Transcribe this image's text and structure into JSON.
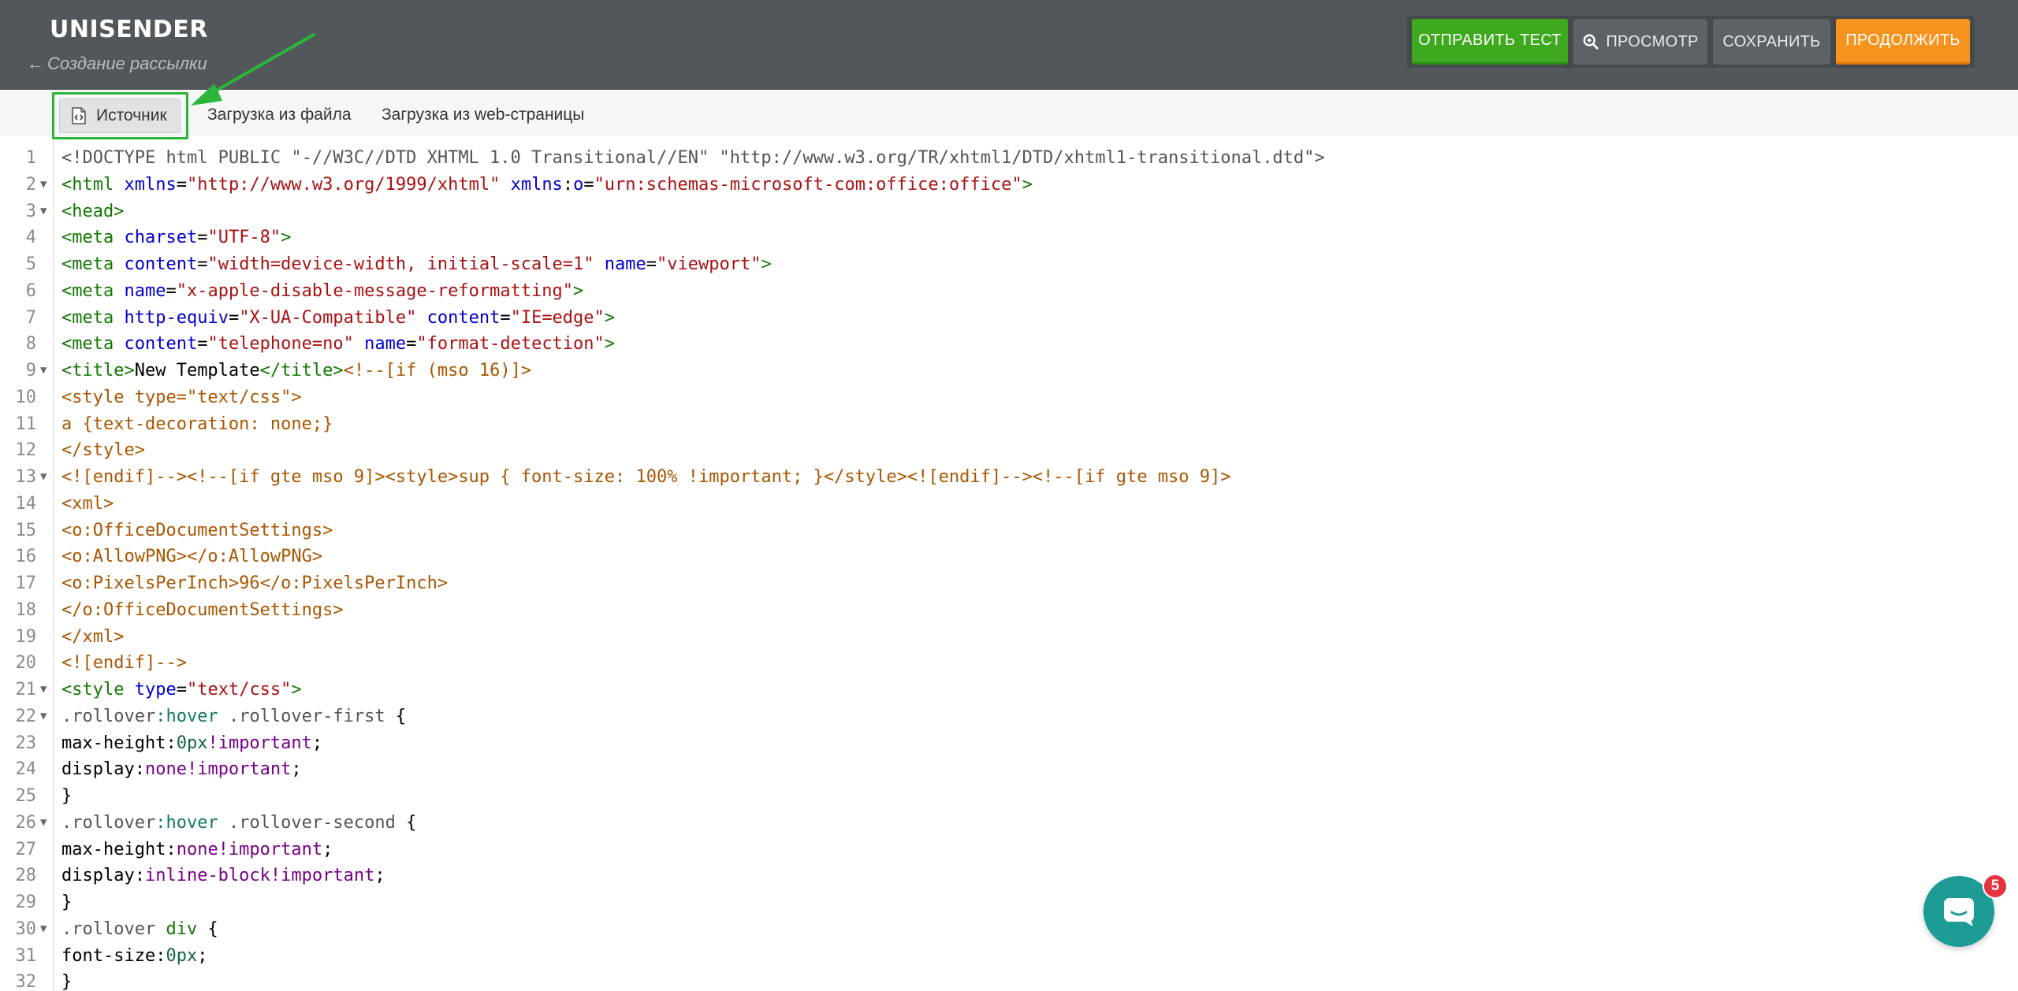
{
  "header": {
    "logo": "UNISENDER",
    "back_arrow": "←",
    "back_label": "Создание рассылки",
    "buttons": {
      "send_test": "ОТПРАВИТЬ ТЕСТ",
      "preview": "ПРОСМОТР",
      "save": "СОХРАНИТЬ",
      "continue": "ПРОДОЛЖИТЬ"
    }
  },
  "tabs": {
    "source": "Источник",
    "from_file": "Загрузка из файла",
    "from_web": "Загрузка из web-страницы"
  },
  "editor": {
    "lines": [
      {
        "n": "1",
        "fold": "",
        "tokens": [
          [
            "t-meta",
            "<!DOCTYPE html PUBLIC \"-//W3C//DTD XHTML 1.0 Transitional//EN\" \"http://www.w3.org/TR/xhtml1/DTD/xhtml1-transitional.dtd\">"
          ]
        ]
      },
      {
        "n": "2",
        "fold": "▼",
        "tokens": [
          [
            "t-tag",
            "<html"
          ],
          [
            "t-plain",
            " "
          ],
          [
            "t-attr",
            "xmlns"
          ],
          [
            "t-plain",
            "="
          ],
          [
            "t-str",
            "\"http://www.w3.org/1999/xhtml\""
          ],
          [
            "t-plain",
            " "
          ],
          [
            "t-attr",
            "xmlns"
          ],
          [
            "t-plain",
            ":"
          ],
          [
            "t-attr",
            "o"
          ],
          [
            "t-plain",
            "="
          ],
          [
            "t-str",
            "\"urn:schemas-microsoft-com:office:office\""
          ],
          [
            "t-tag",
            ">"
          ]
        ]
      },
      {
        "n": "3",
        "fold": "▼",
        "tokens": [
          [
            "t-tag",
            "<head>"
          ]
        ]
      },
      {
        "n": "4",
        "fold": "",
        "tokens": [
          [
            "t-tag",
            "<meta"
          ],
          [
            "t-plain",
            " "
          ],
          [
            "t-attr",
            "charset"
          ],
          [
            "t-plain",
            "="
          ],
          [
            "t-str",
            "\"UTF-8\""
          ],
          [
            "t-tag",
            ">"
          ]
        ]
      },
      {
        "n": "5",
        "fold": "",
        "tokens": [
          [
            "t-tag",
            "<meta"
          ],
          [
            "t-plain",
            " "
          ],
          [
            "t-attr",
            "content"
          ],
          [
            "t-plain",
            "="
          ],
          [
            "t-str",
            "\"width=device-width, initial-scale=1\""
          ],
          [
            "t-plain",
            " "
          ],
          [
            "t-attr",
            "name"
          ],
          [
            "t-plain",
            "="
          ],
          [
            "t-str",
            "\"viewport\""
          ],
          [
            "t-tag",
            ">"
          ]
        ]
      },
      {
        "n": "6",
        "fold": "",
        "tokens": [
          [
            "t-tag",
            "<meta"
          ],
          [
            "t-plain",
            " "
          ],
          [
            "t-attr",
            "name"
          ],
          [
            "t-plain",
            "="
          ],
          [
            "t-str",
            "\"x-apple-disable-message-reformatting\""
          ],
          [
            "t-tag",
            ">"
          ]
        ]
      },
      {
        "n": "7",
        "fold": "",
        "tokens": [
          [
            "t-tag",
            "<meta"
          ],
          [
            "t-plain",
            " "
          ],
          [
            "t-attr",
            "http-equiv"
          ],
          [
            "t-plain",
            "="
          ],
          [
            "t-str",
            "\"X-UA-Compatible\""
          ],
          [
            "t-plain",
            " "
          ],
          [
            "t-attr",
            "content"
          ],
          [
            "t-plain",
            "="
          ],
          [
            "t-str",
            "\"IE=edge\""
          ],
          [
            "t-tag",
            ">"
          ]
        ]
      },
      {
        "n": "8",
        "fold": "",
        "tokens": [
          [
            "t-tag",
            "<meta"
          ],
          [
            "t-plain",
            " "
          ],
          [
            "t-attr",
            "content"
          ],
          [
            "t-plain",
            "="
          ],
          [
            "t-str",
            "\"telephone=no\""
          ],
          [
            "t-plain",
            " "
          ],
          [
            "t-attr",
            "name"
          ],
          [
            "t-plain",
            "="
          ],
          [
            "t-str",
            "\"format-detection\""
          ],
          [
            "t-tag",
            ">"
          ]
        ]
      },
      {
        "n": "9",
        "fold": "▼",
        "tokens": [
          [
            "t-tag",
            "<title>"
          ],
          [
            "t-plain",
            "New Template"
          ],
          [
            "t-tag",
            "</title>"
          ],
          [
            "t-com",
            "<!--[if (mso 16)]>"
          ]
        ]
      },
      {
        "n": "10",
        "fold": "",
        "tokens": [
          [
            "t-com",
            "<style type=\"text/css\">"
          ]
        ]
      },
      {
        "n": "11",
        "fold": "",
        "tokens": [
          [
            "t-com",
            "a {text-decoration: none;}"
          ]
        ]
      },
      {
        "n": "12",
        "fold": "",
        "tokens": [
          [
            "t-com",
            "</style>"
          ]
        ]
      },
      {
        "n": "13",
        "fold": "▼",
        "tokens": [
          [
            "t-com",
            "<![endif]--><!--[if gte mso 9]><style>sup { font-size: 100% !important; }</style><![endif]--><!--[if gte mso 9]>"
          ]
        ]
      },
      {
        "n": "14",
        "fold": "",
        "tokens": [
          [
            "t-com",
            "<xml>"
          ]
        ]
      },
      {
        "n": "15",
        "fold": "",
        "tokens": [
          [
            "t-com",
            "<o:OfficeDocumentSettings>"
          ]
        ]
      },
      {
        "n": "16",
        "fold": "",
        "tokens": [
          [
            "t-com",
            "<o:AllowPNG></o:AllowPNG>"
          ]
        ]
      },
      {
        "n": "17",
        "fold": "",
        "tokens": [
          [
            "t-com",
            "<o:PixelsPerInch>96</o:PixelsPerInch>"
          ]
        ]
      },
      {
        "n": "18",
        "fold": "",
        "tokens": [
          [
            "t-com",
            "</o:OfficeDocumentSettings>"
          ]
        ]
      },
      {
        "n": "19",
        "fold": "",
        "tokens": [
          [
            "t-com",
            "</xml>"
          ]
        ]
      },
      {
        "n": "20",
        "fold": "",
        "tokens": [
          [
            "t-com",
            "<![endif]-->"
          ]
        ]
      },
      {
        "n": "21",
        "fold": "▼",
        "tokens": [
          [
            "t-tag",
            "<style"
          ],
          [
            "t-plain",
            " "
          ],
          [
            "t-attr",
            "type"
          ],
          [
            "t-plain",
            "="
          ],
          [
            "t-str",
            "\"text/css\""
          ],
          [
            "t-tag",
            ">"
          ]
        ]
      },
      {
        "n": "22",
        "fold": "▼",
        "tokens": [
          [
            "t-sel",
            ".rollover"
          ],
          [
            "t-pseudo",
            ":hover"
          ],
          [
            "t-plain",
            " "
          ],
          [
            "t-sel",
            ".rollover-first"
          ],
          [
            "t-plain",
            " {"
          ]
        ]
      },
      {
        "n": "23",
        "fold": "",
        "tokens": [
          [
            "t-prop",
            "max-height"
          ],
          [
            "t-plain",
            ":"
          ],
          [
            "t-num",
            "0px"
          ],
          [
            "t-kw",
            "!important"
          ],
          [
            "t-plain",
            ";"
          ]
        ]
      },
      {
        "n": "24",
        "fold": "",
        "tokens": [
          [
            "t-prop",
            "display"
          ],
          [
            "t-plain",
            ":"
          ],
          [
            "t-kw",
            "none"
          ],
          [
            "t-kw",
            "!important"
          ],
          [
            "t-plain",
            ";"
          ]
        ]
      },
      {
        "n": "25",
        "fold": "",
        "tokens": [
          [
            "t-plain",
            "}"
          ]
        ]
      },
      {
        "n": "26",
        "fold": "▼",
        "tokens": [
          [
            "t-sel",
            ".rollover"
          ],
          [
            "t-pseudo",
            ":hover"
          ],
          [
            "t-plain",
            " "
          ],
          [
            "t-sel",
            ".rollover-second"
          ],
          [
            "t-plain",
            " {"
          ]
        ]
      },
      {
        "n": "27",
        "fold": "",
        "tokens": [
          [
            "t-prop",
            "max-height"
          ],
          [
            "t-plain",
            ":"
          ],
          [
            "t-kw",
            "none"
          ],
          [
            "t-kw",
            "!important"
          ],
          [
            "t-plain",
            ";"
          ]
        ]
      },
      {
        "n": "28",
        "fold": "",
        "tokens": [
          [
            "t-prop",
            "display"
          ],
          [
            "t-plain",
            ":"
          ],
          [
            "t-kw",
            "inline-block"
          ],
          [
            "t-kw",
            "!important"
          ],
          [
            "t-plain",
            ";"
          ]
        ]
      },
      {
        "n": "29",
        "fold": "",
        "tokens": [
          [
            "t-plain",
            "}"
          ]
        ]
      },
      {
        "n": "30",
        "fold": "▼",
        "tokens": [
          [
            "t-sel",
            ".rollover"
          ],
          [
            "t-plain",
            " "
          ],
          [
            "t-tag",
            "div"
          ],
          [
            "t-plain",
            " {"
          ]
        ]
      },
      {
        "n": "31",
        "fold": "",
        "tokens": [
          [
            "t-prop",
            "font-size"
          ],
          [
            "t-plain",
            ":"
          ],
          [
            "t-num",
            "0px"
          ],
          [
            "t-plain",
            ";"
          ]
        ]
      },
      {
        "n": "32",
        "fold": "",
        "tokens": [
          [
            "t-plain",
            "}"
          ]
        ]
      }
    ]
  },
  "chat": {
    "badge_count": "5"
  },
  "colors": {
    "header_bg": "#52575c",
    "send_test": "#3ea81f",
    "continue": "#f7931e",
    "highlight": "#2bb53a",
    "chat": "#1d9b95",
    "badge": "#e8323f"
  }
}
